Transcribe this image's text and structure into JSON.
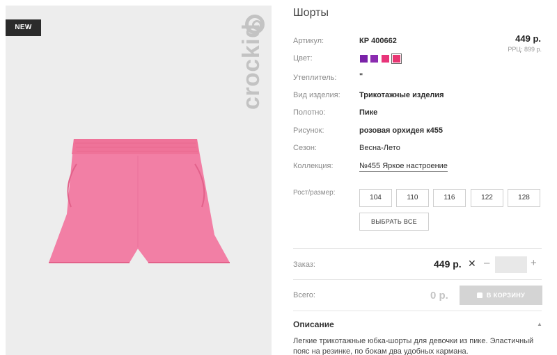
{
  "product": {
    "badge": "NEW",
    "brand": "crockid",
    "title": "Шорты"
  },
  "specs": {
    "article_label": "Артикул:",
    "article_value": "КР 400662",
    "color_label": "Цвет:",
    "insulation_label": "Утеплитель:",
    "insulation_value": "\"",
    "type_label": "Вид изделия:",
    "type_value": "Трикотажные изделия",
    "fabric_label": "Полотно:",
    "fabric_value": "Пике",
    "print_label": "Рисунок:",
    "print_value": "розовая орхидея к455",
    "season_label": "Сезон:",
    "season_value": "Весна-Лето",
    "collection_label": "Коллекция:",
    "collection_value": "№455 Яркое настроение"
  },
  "pricing": {
    "price": "449 р.",
    "rrp": "РРЦ: 899 р."
  },
  "colors": [
    "#7a22a8",
    "#8b2bb0",
    "#e8357a",
    "#e83572"
  ],
  "sizes": {
    "label": "Рост/размер:",
    "options": [
      "104",
      "110",
      "116",
      "122",
      "128"
    ],
    "select_all": "ВЫБРАТЬ ВСЕ"
  },
  "order": {
    "label": "Заказ:",
    "price": "449 р.",
    "times": "✕",
    "minus": "–",
    "plus": "+",
    "quantity": ""
  },
  "total": {
    "label": "Всего:",
    "value": "0 р.",
    "cart_button": "В КОРЗИНУ"
  },
  "description": {
    "title": "Описание",
    "text": "Легкие трикотажные юбка-шорты для девочки из пике. Эластичный пояс на резинке, по бокам два удобных кармана."
  }
}
